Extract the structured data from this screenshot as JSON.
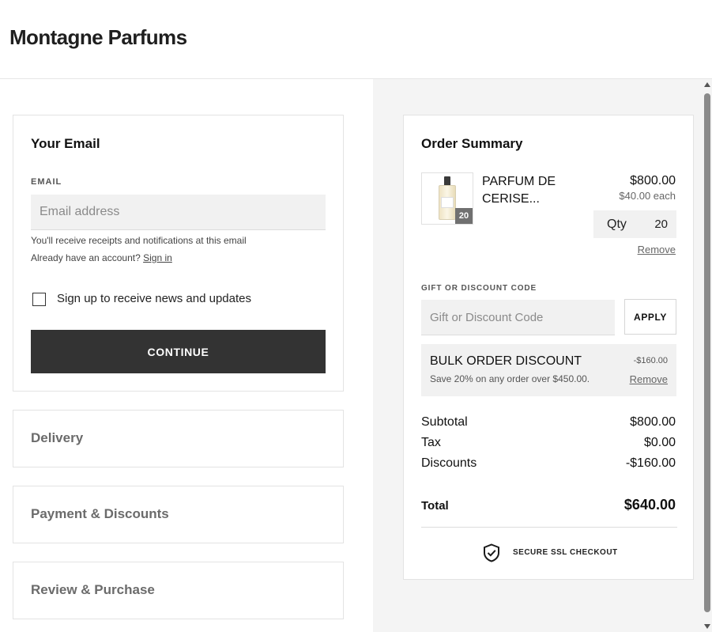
{
  "header": {
    "brand": "Montagne Parfums"
  },
  "email_section": {
    "title": "Your Email",
    "field_label": "EMAIL",
    "placeholder": "Email address",
    "value": "",
    "receipt_note": "You'll receive receipts and notifications at this email",
    "account_prompt": "Already have an account?",
    "sign_in_label": "Sign in",
    "newsletter_label": "Sign up to receive news and updates",
    "newsletter_checked": false,
    "continue_label": "CONTINUE"
  },
  "steps": [
    {
      "label": "Delivery"
    },
    {
      "label": "Payment & Discounts"
    },
    {
      "label": "Review & Purchase"
    }
  ],
  "order_summary": {
    "title": "Order Summary",
    "item": {
      "name": "PARFUM DE CERISE...",
      "price": "$800.00",
      "unit_price": "$40.00 each",
      "quantity_badge": "20",
      "qty_label": "Qty",
      "qty_value": "20",
      "remove_label": "Remove"
    },
    "gift": {
      "label": "GIFT OR DISCOUNT CODE",
      "placeholder": "Gift or Discount Code",
      "apply_label": "APPLY"
    },
    "discount": {
      "name": "BULK ORDER DISCOUNT",
      "description": "Save 20% on any order over $450.00.",
      "amount": "-$160.00",
      "remove_label": "Remove"
    },
    "totals": {
      "subtotal_label": "Subtotal",
      "subtotal_value": "$800.00",
      "tax_label": "Tax",
      "tax_value": "$0.00",
      "discounts_label": "Discounts",
      "discounts_value": "-$160.00",
      "total_label": "Total",
      "total_value": "$640.00"
    },
    "secure_label": "SECURE SSL CHECKOUT"
  },
  "icons": {
    "ssl": "shield-check-icon",
    "product": "perfume-bottle-icon"
  },
  "colors": {
    "primary_button": "#333333",
    "panel_background": "#f4f4f4",
    "input_background": "#f1f1f1"
  }
}
